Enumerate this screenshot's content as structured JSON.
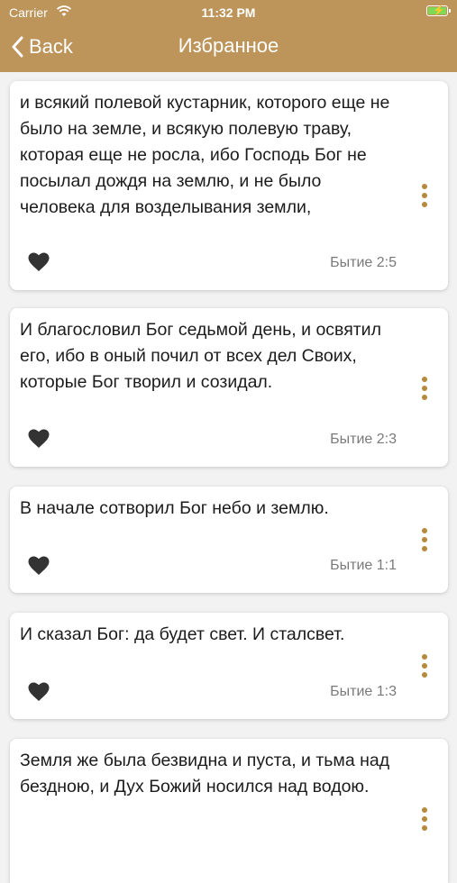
{
  "status_bar": {
    "carrier": "Carrier",
    "time": "11:32 PM"
  },
  "nav": {
    "back_label": "Back",
    "title": "Избранное"
  },
  "colors": {
    "header": "#bd945a",
    "accent": "#b68a3e",
    "battery": "#7ed957"
  },
  "icons": {
    "back": "chevron-left-icon",
    "favorite": "heart-icon",
    "menu": "more-vertical-icon",
    "wifi": "wifi-icon",
    "battery": "battery-charging-icon"
  },
  "favorites": [
    {
      "text": "и всякий полевой кустарник, которого еще не было на земле, и всякую полевую траву, которая еще не росла, ибо Господь Бог не посылал дождя на землю, и не было человека для возделывания земли,",
      "reference": "Бытие 2:5"
    },
    {
      "text": "И благословил Бог седьмой день, и освятил его, ибо в оный почил от всех дел Своих, которые Бог творил и созидал.",
      "reference": "Бытие 2:3"
    },
    {
      "text": "В начале сотворил Бог небо и землю.",
      "reference": "Бытие 1:1"
    },
    {
      "text": "И сказал Бог: да будет свет. И сталсвет.",
      "reference": "Бытие 1:3"
    },
    {
      "text": "Земля же была безвидна и пуста, и тьма над бездною, и Дух Божий носился над водою.",
      "reference": ""
    }
  ]
}
